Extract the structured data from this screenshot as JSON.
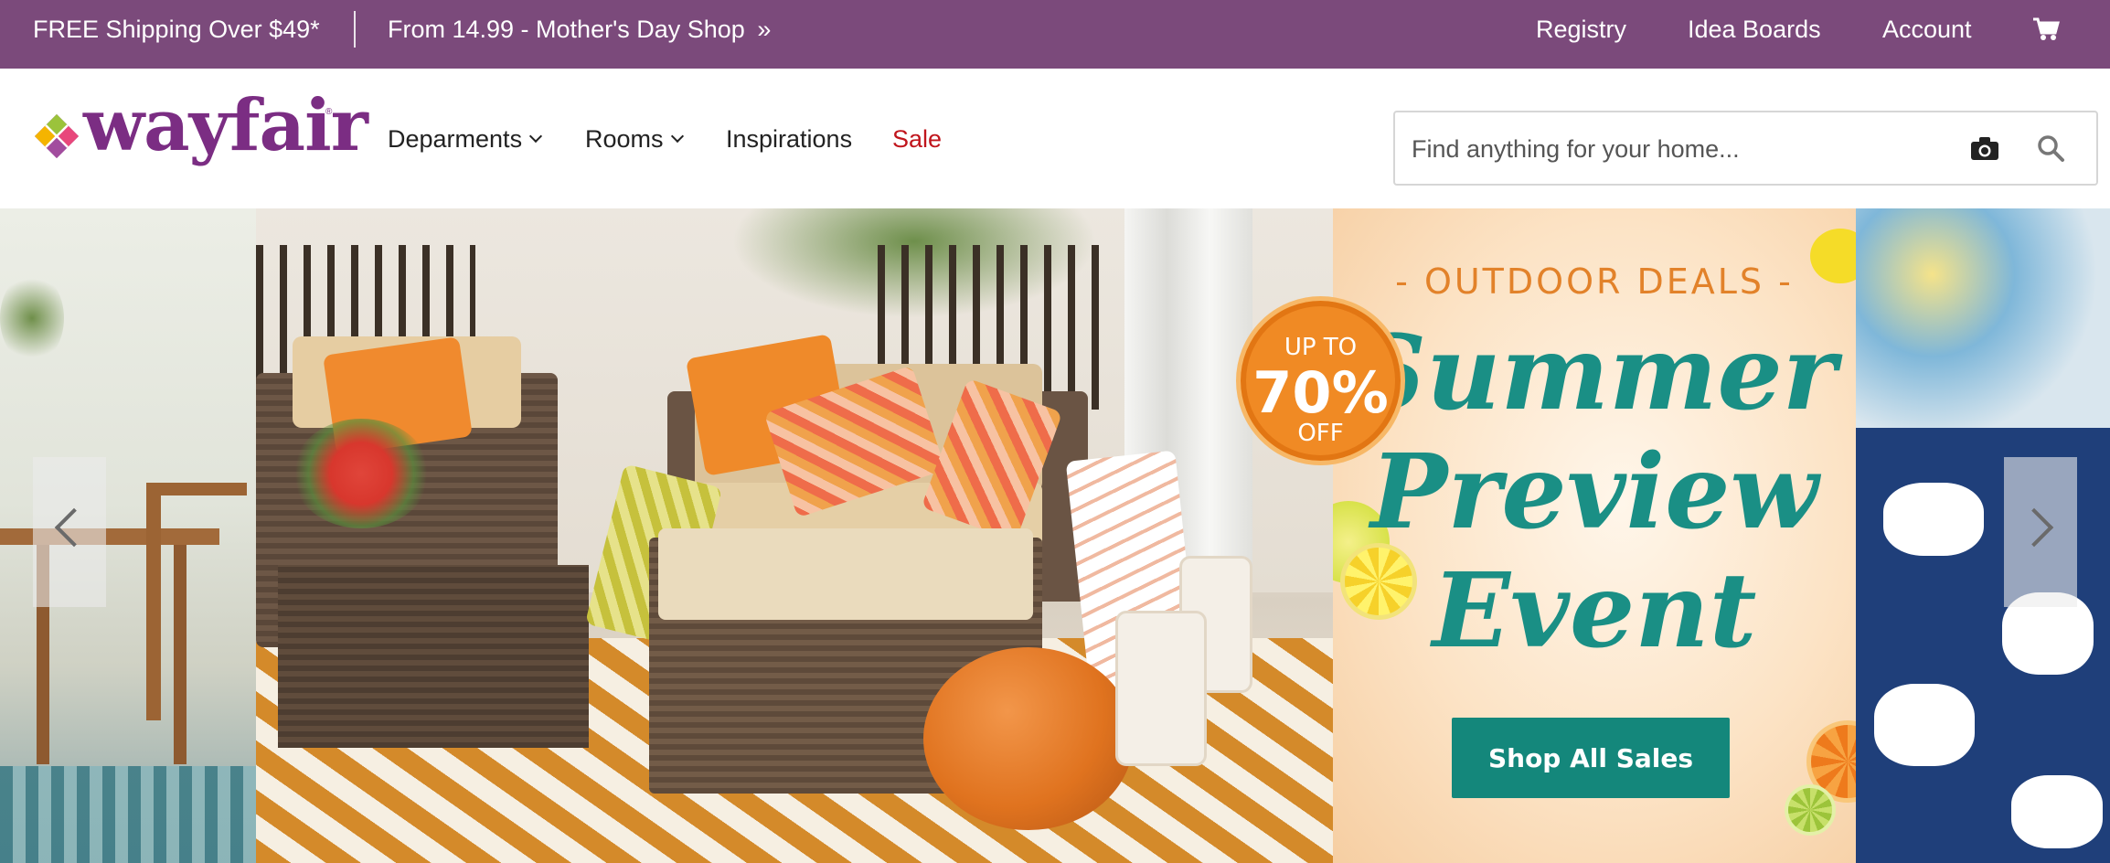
{
  "topbar": {
    "shipping": "FREE Shipping Over $49*",
    "mothers_day": "From 14.99 - Mother's Day Shop",
    "mothers_day_icon": "double-chevron-right-icon",
    "registry": "Registry",
    "idea_boards": "Idea Boards",
    "account": "Account",
    "cart_icon": "cart-icon",
    "background_color": "#7b4a7b"
  },
  "header": {
    "logo_text": "wayfair",
    "nav": [
      {
        "label": "Deparments",
        "has_dropdown": true
      },
      {
        "label": "Rooms",
        "has_dropdown": true
      },
      {
        "label": "Inspirations",
        "has_dropdown": false
      },
      {
        "label": "Sale",
        "has_dropdown": false,
        "color": "#c0151c"
      }
    ],
    "search": {
      "placeholder": "Find anything for your home...",
      "value": "",
      "camera_icon": "camera-icon",
      "search_icon": "search-icon"
    }
  },
  "carousel": {
    "badge": {
      "line1": "UP TO",
      "line2": "70%",
      "line3": "OFF"
    },
    "promo": {
      "kicker": "- OUTDOOR DEALS -",
      "script_lines": [
        "Summer",
        "Preview",
        "Event"
      ],
      "cta": "Shop All Sales",
      "cta_color": "#14877b",
      "script_color": "#1a8f85",
      "kicker_color": "#e2822a"
    },
    "prev_icon": "chevron-left-icon",
    "next_icon": "chevron-right-icon"
  }
}
